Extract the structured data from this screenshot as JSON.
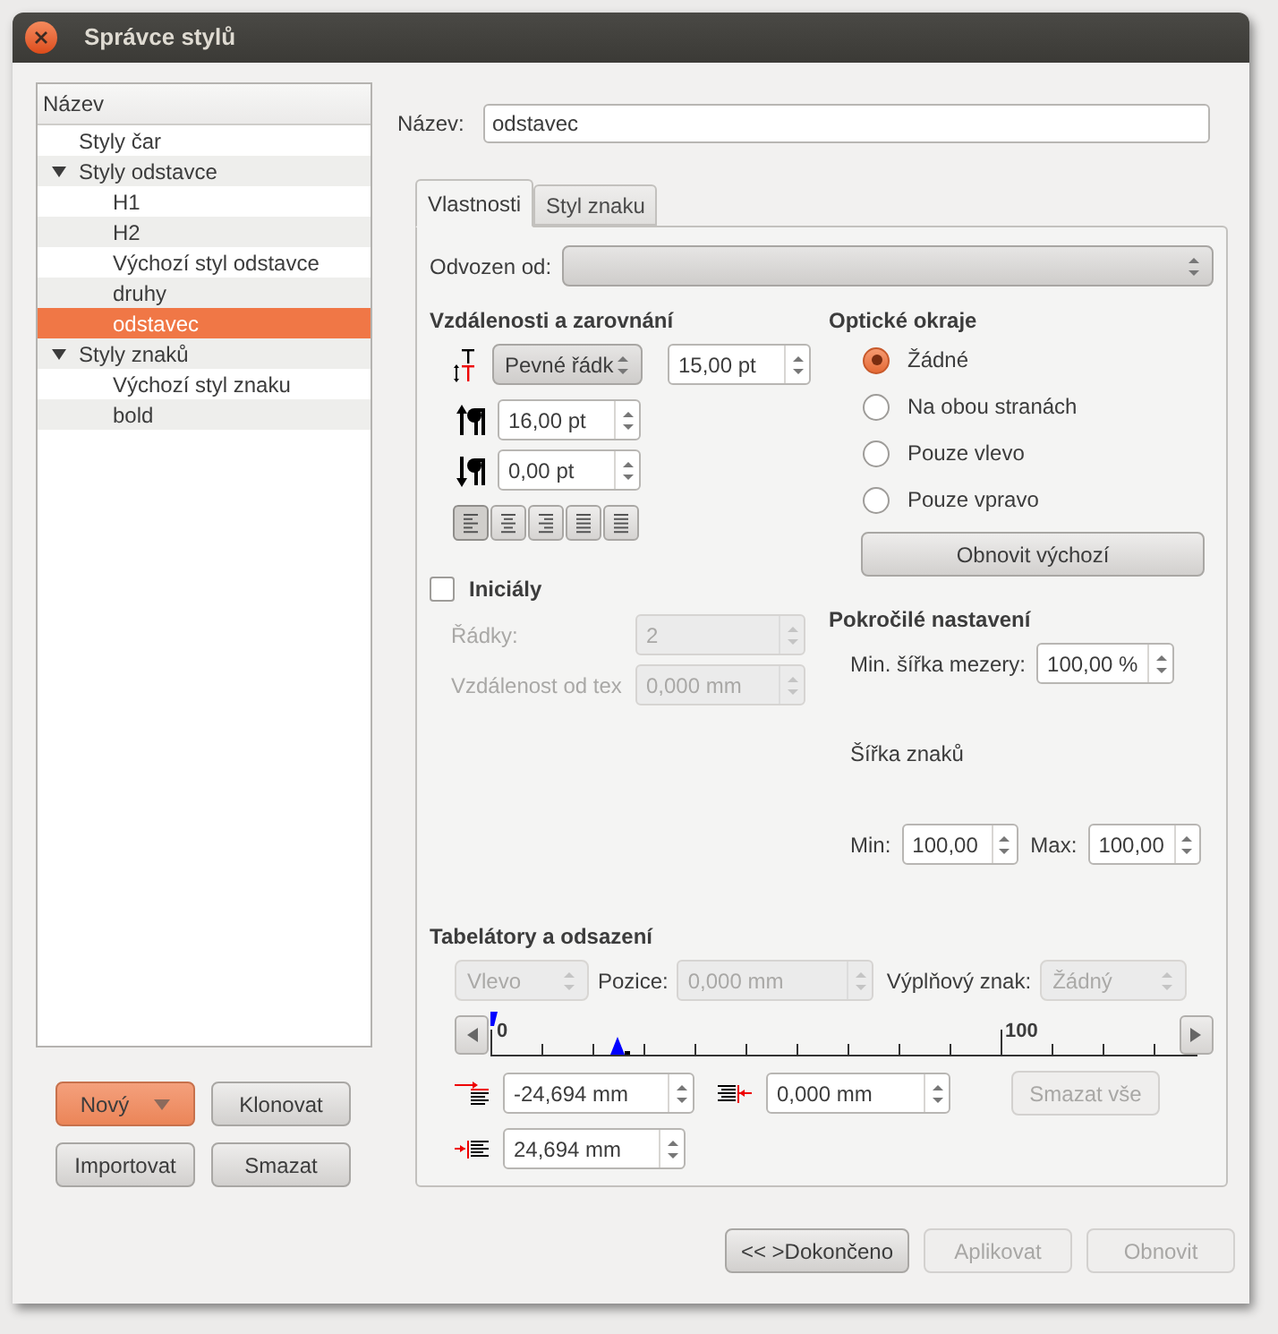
{
  "window": {
    "title": "Správce stylů"
  },
  "style_list": {
    "header": "Název",
    "items": [
      {
        "label": "Styly čar",
        "selected": false
      },
      {
        "label": "Styly odstavce",
        "selected": false,
        "expanded": true,
        "children": [
          {
            "label": "H1",
            "selected": false
          },
          {
            "label": "H2",
            "selected": false
          },
          {
            "label": "Výchozí styl odstavce",
            "selected": false
          },
          {
            "label": "druhy",
            "selected": false
          },
          {
            "label": "odstavec",
            "selected": true
          }
        ]
      },
      {
        "label": "Styly znaků",
        "selected": false,
        "expanded": true,
        "children": [
          {
            "label": "Výchozí styl znaku",
            "selected": false
          },
          {
            "label": "bold",
            "selected": false
          }
        ]
      }
    ]
  },
  "list_buttons": [
    {
      "label": "Nový",
      "kind": "menu",
      "default": true
    },
    {
      "label": "Klonovat",
      "kind": "plain",
      "default": false
    },
    {
      "label": "Importovat",
      "kind": "plain",
      "default": false
    },
    {
      "label": "Smazat",
      "kind": "plain",
      "default": false
    }
  ],
  "name_field": {
    "label": "Název:",
    "value": "odstavec"
  },
  "tabs": [
    {
      "label": "Vlastnosti",
      "selected": true
    },
    {
      "label": "Styl znaku",
      "selected": false
    }
  ],
  "based_on": {
    "label": "Odvozen od:"
  },
  "spacing": {
    "title": "Vzdálenosti a zarovnání",
    "line_mode": "Pevné řádk",
    "line_value": "15,00 pt",
    "above": "16,00 pt",
    "below": "0,00 pt",
    "alignments": [
      {
        "selected": true
      },
      {
        "selected": false
      },
      {
        "selected": false
      },
      {
        "selected": false
      },
      {
        "selected": false
      }
    ]
  },
  "optical": {
    "title": "Optické okraje",
    "options": [
      {
        "label": "Žádné",
        "selected": true
      },
      {
        "label": "Na obou stranách",
        "selected": false
      },
      {
        "label": "Pouze vlevo",
        "selected": false
      },
      {
        "label": "Pouze vpravo",
        "selected": false
      }
    ],
    "reset": "Obnovit výchozí"
  },
  "initials": {
    "label": "Iniciály",
    "checked": false,
    "lines_label": "Řádky:",
    "lines": "2",
    "distance_label": "Vzdálenost od tex",
    "distance": "0,000 mm"
  },
  "advanced": {
    "title": "Pokročilé nastavení",
    "min_space_label": "Min. šířka mezery:",
    "min_space": "100,00 %",
    "glyph_title": "Šířka znaků",
    "min_label": "Min:",
    "min": "100,00",
    "max_label": "Max:",
    "max": "100,00"
  },
  "tabs_indents": {
    "title": "Tabelátory a odsazení",
    "disabled": true,
    "alignment": "Vlevo",
    "position_label": "Pozice:",
    "position": "0,000 mm",
    "fill_label": "Výplňový znak:",
    "fill": "Žádný",
    "ruler_labels": [
      "0",
      "100"
    ],
    "first_line": "-24,694 mm",
    "right": "0,000 mm",
    "left": "24,694 mm",
    "clear_all": "Smazat vše"
  },
  "footer_buttons": [
    {
      "label": "<< >Dokončeno",
      "disabled": false
    },
    {
      "label": "Aplikovat",
      "disabled": true
    },
    {
      "label": "Obnovit",
      "disabled": true
    }
  ]
}
